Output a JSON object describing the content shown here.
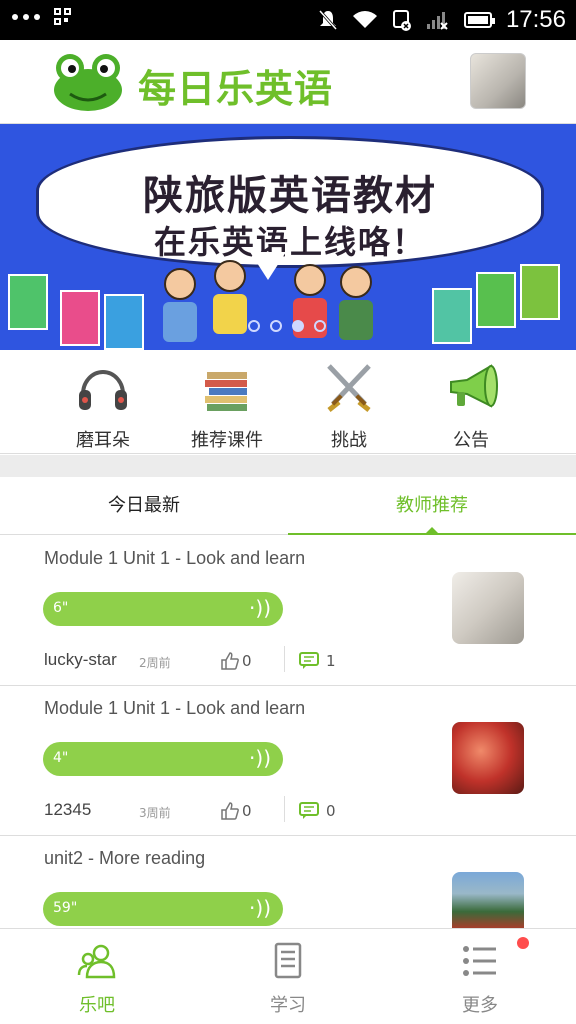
{
  "status_bar": {
    "time": "17:56"
  },
  "header": {
    "app_title": "每日乐英语"
  },
  "banner": {
    "line1": "陕旅版英语教材",
    "line2": "在乐英语上线咯！",
    "pager": {
      "count": 4,
      "active": 1
    }
  },
  "quick_nav": [
    {
      "label": "磨耳朵",
      "icon": "headphones-icon"
    },
    {
      "label": "推荐课件",
      "icon": "books-icon"
    },
    {
      "label": "挑战",
      "icon": "crossed-swords-icon"
    },
    {
      "label": "公告",
      "icon": "megaphone-icon"
    }
  ],
  "tabs": [
    {
      "label": "今日最新",
      "active": false
    },
    {
      "label": "教师推荐",
      "active": true
    }
  ],
  "feed": [
    {
      "title": "Module 1 Unit 1 - Look and learn",
      "duration": "6\"",
      "user": "lucky-star",
      "time": "2周前",
      "likes": "0",
      "comments": "1"
    },
    {
      "title": "Module 1 Unit 1 - Look and learn",
      "duration": "4\"",
      "user": "12345",
      "time": "3周前",
      "likes": "0",
      "comments": "0"
    },
    {
      "title": "unit2 - More reading",
      "duration": "59\"",
      "user": "",
      "time": "",
      "likes": "",
      "comments": ""
    }
  ],
  "bottom_nav": [
    {
      "label": "乐吧",
      "icon": "community-icon",
      "active": true
    },
    {
      "label": "学习",
      "icon": "notebook-icon",
      "active": false
    },
    {
      "label": "更多",
      "icon": "list-icon",
      "active": false,
      "badge": true
    }
  ],
  "colors": {
    "accent": "#6fbf2a",
    "audio_bar": "#8fd04a",
    "banner_bg": "#2f55e0",
    "badge": "#ff4d4d"
  }
}
